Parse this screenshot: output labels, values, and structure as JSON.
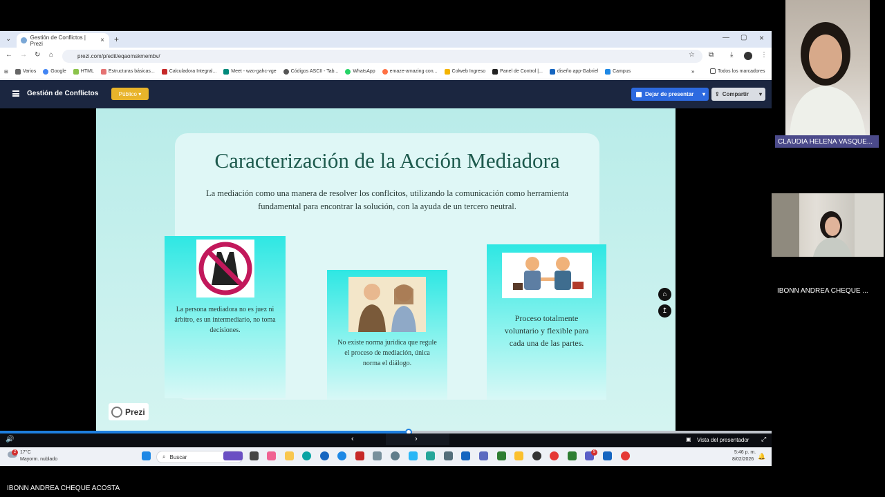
{
  "browser": {
    "tab_title": "Gestión de Conflictos | Prezi",
    "url": "prezi.com/p/edit/eqaomskmembv/",
    "bookmarks": [
      "Varios",
      "Google",
      "HTML",
      "Estructuras básicas...",
      "Calculadora Integral...",
      "Meet - wzo-gahc-vge",
      "Códigos ASCII - Tab...",
      "WhatsApp",
      "emaze-amazing con...",
      "Colweb Ingreso",
      "Panel de Control |...",
      "diseño app-Gabriel",
      "Campus"
    ],
    "all_bookmarks": "Todos los marcadores"
  },
  "prezi": {
    "title": "Gestión de Conflictos",
    "public_label": "Público",
    "stop_label": "Dejar de presentar",
    "share_label": "Compartir",
    "logo_text": "Prezi",
    "presenter_view": "Vista del presentador"
  },
  "slide": {
    "title": "Caracterización de la Acción Mediadora",
    "subtitle": "La mediación como una manera de resolver los conflcitos, utilizando la comunicación como herramienta fundamental para encontrar la solución, con la ayuda de un tercero neutral.",
    "box1": "La persona mediadora no es juez ni árbitro, es un intermediario, no toma decisiones.",
    "box2": "No existe norma jurídica que regule el proceso de mediación, única norma el diálogo.",
    "box3": "Proceso totalmente voluntario y flexible para cada una de las partes."
  },
  "progress": {
    "fraction": 0.53
  },
  "taskbar": {
    "weather_temp": "17°C",
    "weather_desc": "Mayorm. nublado",
    "weather_badge": "2",
    "search": "Buscar",
    "time": "5:46 p. m.",
    "date": "8/02/2026",
    "teams_badge": "9"
  },
  "participants": {
    "name1": "CLAUDIA HELENA VASQUE...",
    "name2": "IBONN ANDREA CHEQUE ...",
    "bottom_name": "IBONN ANDREA CHEQUE ACOSTA"
  }
}
